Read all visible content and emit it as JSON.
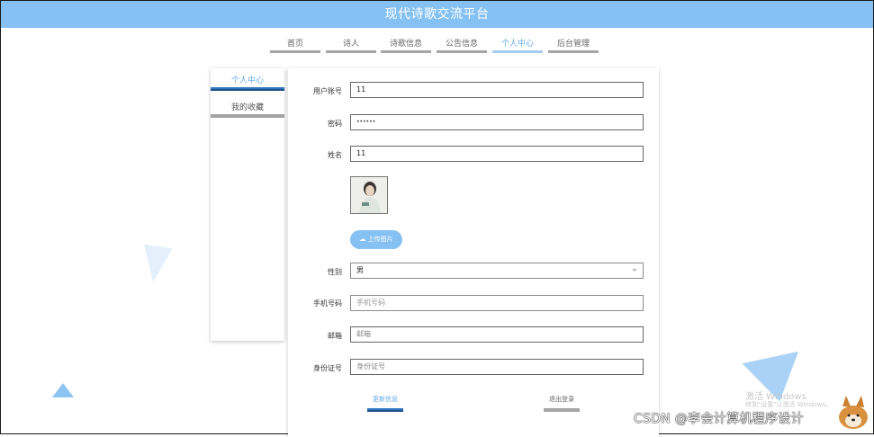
{
  "header": {
    "title": "现代诗歌交流平台"
  },
  "nav": {
    "items": [
      {
        "label": "首页"
      },
      {
        "label": "诗人"
      },
      {
        "label": "诗歌信息"
      },
      {
        "label": "公告信息"
      },
      {
        "label": "个人中心"
      },
      {
        "label": "后台管理"
      }
    ],
    "active": "个人中心"
  },
  "sidebar": {
    "items": [
      {
        "label": "个人中心"
      },
      {
        "label": "我的收藏"
      }
    ]
  },
  "form": {
    "account_label": "用户账号",
    "account_value": "11",
    "password_label": "密码",
    "password_value": "••••••",
    "name_label": "姓名",
    "name_value": "11",
    "upload_label": "上传图片",
    "gender_label": "性别",
    "gender_value": "男",
    "phone_label": "手机号码",
    "phone_placeholder": "手机号码",
    "email_label": "邮箱",
    "email_placeholder": "邮箱",
    "idcard_label": "身份证号",
    "idcard_placeholder": "身份证号"
  },
  "actions": {
    "update_label": "更新信息",
    "logout_label": "退出登录"
  },
  "overlay": {
    "activate_title": "激活 Windows",
    "activate_sub": "转到\"设置\"以激活 Windows。",
    "watermark": "CSDN @李会计算机程序设计"
  },
  "colors": {
    "header_bg": "#86c1f4",
    "accent": "#5fa8ea",
    "active_bar_dark": "#1a5086"
  }
}
